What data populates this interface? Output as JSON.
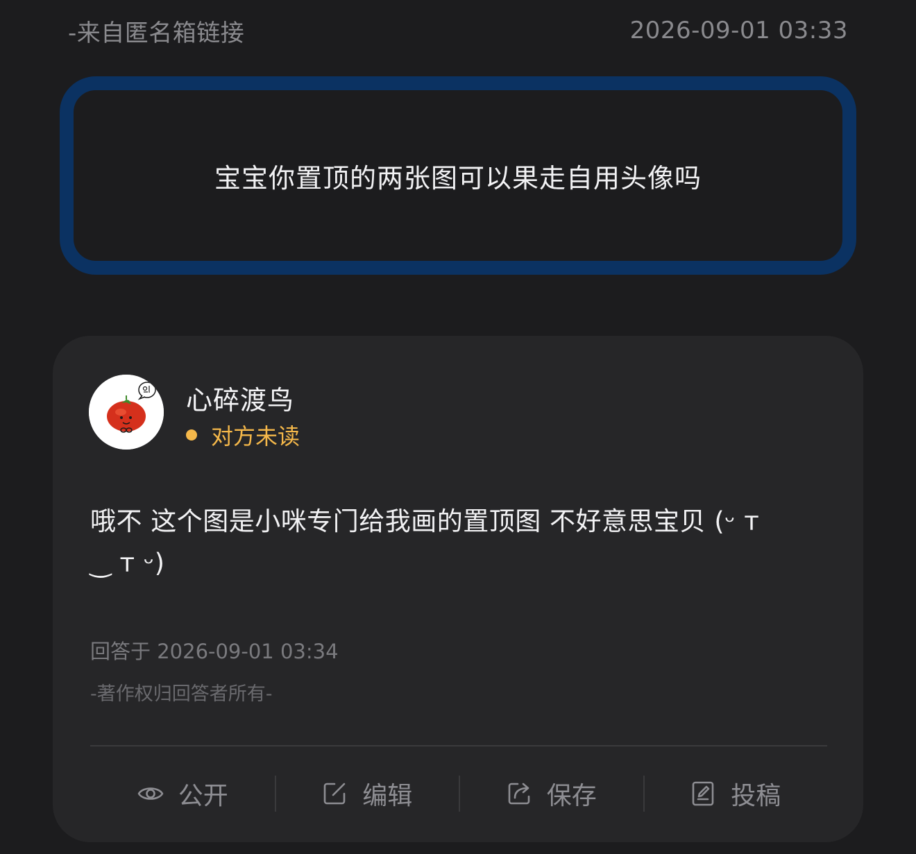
{
  "header": {
    "source": "-来自匿名箱链接",
    "timestamp": "2026-09-01 03:33"
  },
  "question": {
    "text": "宝宝你置顶的两张图可以果走自用头像吗"
  },
  "answer": {
    "user_name": "心碎渡鸟",
    "read_status": "对方未读",
    "text": "哦不 这个图是小咪专门给我画的置顶图 不好意思宝贝 (ᵕ ᴛ \n‿ ᴛ ᵕ)",
    "answered_at": "回答于 2026-09-01 03:34",
    "copyright": "-著作权归回答者所有-"
  },
  "actions": [
    {
      "label": "公开",
      "icon": "eye-icon"
    },
    {
      "label": "编辑",
      "icon": "edit-icon"
    },
    {
      "label": "保存",
      "icon": "share-out-icon"
    },
    {
      "label": "投稿",
      "icon": "document-icon"
    }
  ],
  "colors": {
    "background": "#1c1c1e",
    "card": "#262628",
    "question_border": "#0b3262",
    "status": "#f5b84a"
  }
}
